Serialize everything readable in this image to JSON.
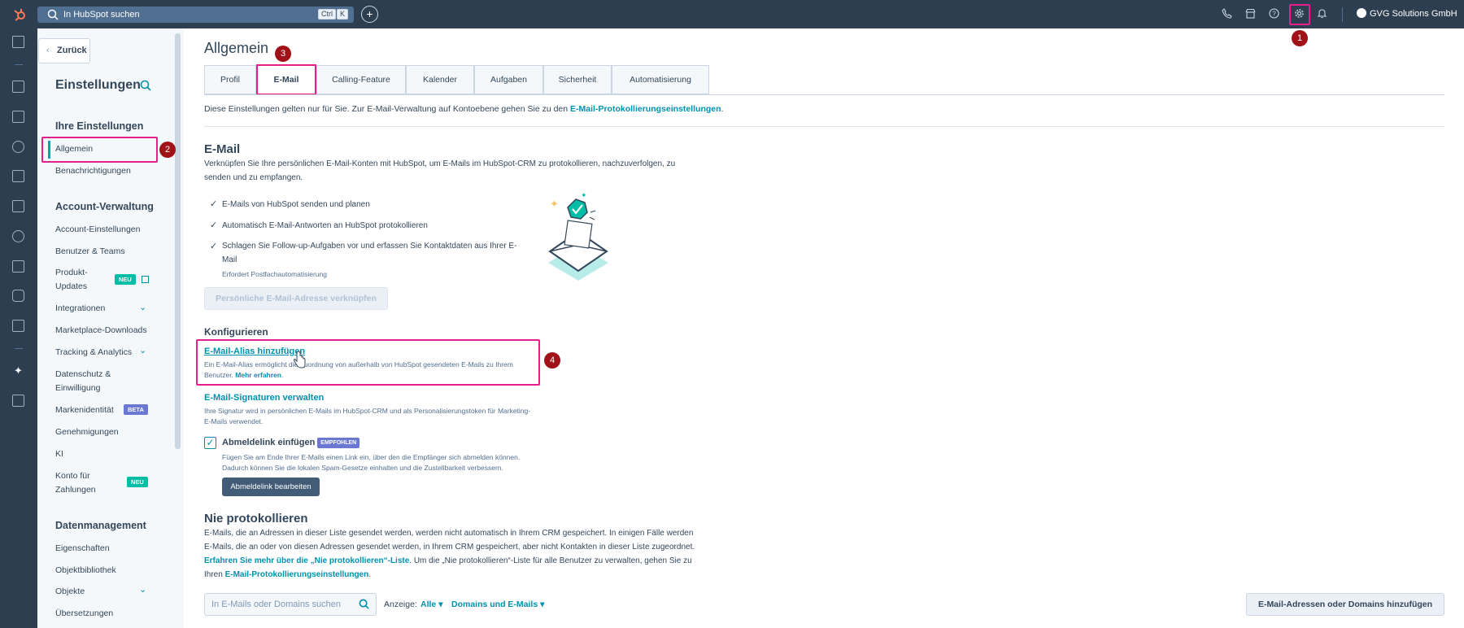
{
  "topbar": {
    "search_placeholder": "In HubSpot suchen",
    "shortcut_ctrl": "Ctrl",
    "shortcut_k": "K",
    "account_name": "GVG Solutions GmbH"
  },
  "sidebar": {
    "back_label": "Zurück",
    "title": "Einstellungen",
    "section_own": "Ihre Einstellungen",
    "item_allgemein": "Allgemein",
    "item_benachrichtigungen": "Benachrichtigungen",
    "section_account": "Account-Verwaltung",
    "item_account_einstellungen": "Account-Einstellungen",
    "item_benutzer_teams": "Benutzer & Teams",
    "item_produkt_updates_1": "Produkt-",
    "item_produkt_updates_2": "Updates",
    "badge_neu": "NEU",
    "item_integrationen": "Integrationen",
    "item_marketplace": "Marketplace-Downloads",
    "item_tracking": "Tracking & Analytics",
    "item_datenschutz_1": "Datenschutz &",
    "item_datenschutz_2": "Einwilligung",
    "item_markenidentitaet": "Markenidentität",
    "badge_beta": "BETA",
    "item_genehmigungen": "Genehmigungen",
    "item_ki": "KI",
    "item_konto_1": "Konto für",
    "item_konto_2": "Zahlungen",
    "section_daten": "Datenmanagement",
    "item_eigenschaften": "Eigenschaften",
    "item_objektbibliothek": "Objektbibliothek",
    "item_objekte": "Objekte",
    "item_uebersetzungen": "Übersetzungen"
  },
  "markers": [
    "1",
    "2",
    "3",
    "4"
  ],
  "main": {
    "title": "Allgemein",
    "tabs": [
      "Profil",
      "E-Mail",
      "Calling-Feature",
      "Kalender",
      "Aufgaben",
      "Sicherheit",
      "Automatisierung"
    ],
    "intro_text": "Diese Einstellungen gelten nur für Sie. Zur E-Mail-Verwaltung auf Kontoebene gehen Sie zu den ",
    "intro_link": "E-Mail-Protokollierungseinstellungen",
    "intro_end": ".",
    "email_heading": "E-Mail",
    "email_desc_1": "Verknüpfen Sie Ihre persönlichen E-Mail-Konten mit HubSpot, um E-Mails im HubSpot-CRM zu protokollieren, nachzuverfolgen, zu",
    "email_desc_2": "senden und zu empfangen.",
    "feature_1": "E-Mails von HubSpot senden und planen",
    "feature_2": "Automatisch E-Mail-Antworten an HubSpot protokollieren",
    "feature_3a": "Schlagen Sie Follow-up-Aufgaben vor und erfassen Sie Kontaktdaten aus Ihrer E-",
    "feature_3b": "Mail",
    "feature_3_note": "Erfordert Postfachautomatisierung",
    "connect_button": "Persönliche E-Mail-Adresse verknüpfen",
    "configure_heading": "Konfigurieren",
    "alias_link": "E-Mail-Alias hinzufügen",
    "alias_desc_1": "Ein E-Mail-Alias ermöglicht die Zuordnung von außerhalb von HubSpot gesendeten E-Mails zu Ihrem",
    "alias_desc_2": "Benutzer. ",
    "alias_more": "Mehr erfahren",
    "alias_desc_end": ".",
    "signature_link": "E-Mail-Signaturen verwalten",
    "signature_desc_1": "Ihre Signatur wird in persönlichen E-Mails im HubSpot-CRM und als Personalisierungstoken für Marketing-",
    "signature_desc_2": "E-Mails verwendet.",
    "unsub_label": "Abmeldelink einfügen",
    "unsub_badge": "EMPFOHLEN",
    "unsub_desc_1": "Fügen Sie am Ende Ihrer E-Mails einen Link ein, über den die Empfänger sich abmelden können.",
    "unsub_desc_2": "Dadurch können Sie die lokalen Spam-Gesetze einhalten und die Zustellbarkeit verbessern.",
    "unsub_button": "Abmeldelink bearbeiten",
    "never_heading": "Nie protokollieren",
    "never_desc_1": "E-Mails, die an Adressen in dieser Liste gesendet werden, werden nicht automatisch in Ihrem CRM gespeichert. In einigen Fälle werden",
    "never_desc_2": "E-Mails, die an oder von diesen Adressen gesendet werden, in Ihrem CRM gespeichert, aber nicht Kontakten in dieser Liste zugeordnet.",
    "never_link": "Erfahren Sie mehr über die „Nie protokollieren“-Liste",
    "never_desc_3": ". Um die „Nie protokollieren“-Liste für alle Benutzer zu verwalten, gehen Sie zu",
    "never_desc_4": "Ihren ",
    "never_link_2": "E-Mail-Protokollierungseinstellungen",
    "never_end": ".",
    "filter_placeholder": "In E-Mails oder Domains suchen",
    "anzeige_label": "Anzeige:",
    "anzeige_value": "Alle",
    "type_value": "Domains und E-Mails",
    "add_button": "E-Mail-Adressen oder Domains hinzufügen"
  }
}
